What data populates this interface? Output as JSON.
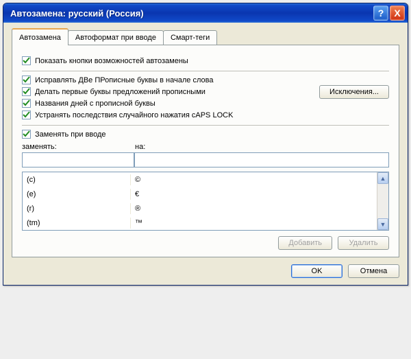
{
  "window": {
    "title": "Автозамена: русский (Россия)"
  },
  "titlebar": {
    "help_symbol": "?",
    "close_symbol": "X"
  },
  "tabs": [
    {
      "label": "Автозамена",
      "active": true
    },
    {
      "label": "Автоформат при вводе",
      "active": false
    },
    {
      "label": "Смарт-теги",
      "active": false
    }
  ],
  "options": {
    "show_buttons": "Показать кнопки возможностей автозамены",
    "two_caps": "Исправлять ДВе ПРописные буквы в начале слова",
    "sentence_caps": "Делать первые буквы предложений прописными",
    "day_caps": "Названия дней с прописной буквы",
    "caps_lock": "Устранять последствия случайного нажатия cAPS LOCK",
    "replace_on_type": "Заменять при вводе"
  },
  "buttons": {
    "exceptions": "Исключения...",
    "add": "Добавить",
    "delete": "Удалить",
    "ok": "OK",
    "cancel": "Отмена"
  },
  "columns": {
    "replace": "заменять:",
    "with": "на:"
  },
  "inputs": {
    "replace_value": "",
    "with_value": ""
  },
  "list": [
    {
      "from": "(c)",
      "to": "©"
    },
    {
      "from": "(e)",
      "to": "€"
    },
    {
      "from": "(r)",
      "to": "®"
    },
    {
      "from": "(tm)",
      "to": "™"
    }
  ],
  "scroll": {
    "up": "▲",
    "down": "▼"
  }
}
